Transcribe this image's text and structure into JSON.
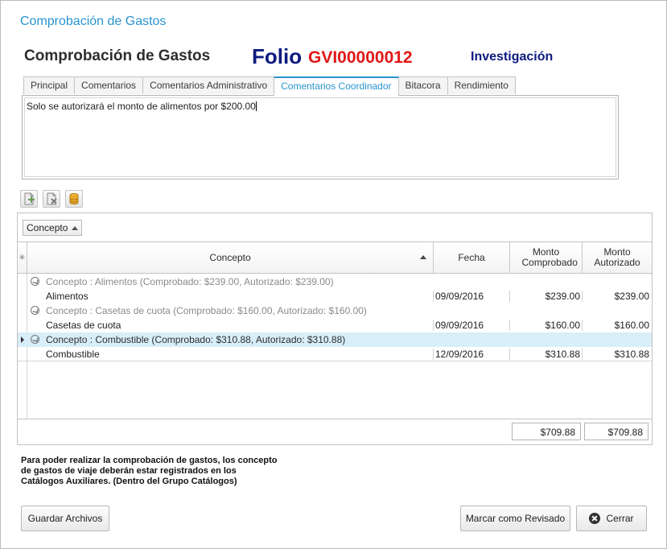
{
  "window": {
    "title": "Comprobación de Gastos"
  },
  "header": {
    "form_title": "Comprobación de Gastos",
    "folio_label": "Folio",
    "folio_number": "GVI00000012",
    "department": "Investigación"
  },
  "tabs": [
    {
      "label": "Principal"
    },
    {
      "label": "Comentarios"
    },
    {
      "label": "Comentarios Administrativo"
    },
    {
      "label": "Comentarios Coordinador",
      "active": true
    },
    {
      "label": "Bitacora"
    },
    {
      "label": "Rendimiento"
    }
  ],
  "comment": {
    "text": "Solo se autorizará el monto de alimentos por $200.00"
  },
  "toolbar": {
    "icons": [
      "add-document-icon",
      "delete-document-icon",
      "database-icon"
    ]
  },
  "grid": {
    "group_by_label": "Concepto",
    "columns": {
      "concepto": "Concepto",
      "fecha": "Fecha",
      "monto_comprobado": "Monto Comprobado",
      "monto_autorizado": "Monto Autorizado"
    },
    "groups": [
      {
        "header": "Concepto : Alimentos (Comprobado: $239.00, Autorizado: $239.00)",
        "row": {
          "concepto": "Alimentos",
          "fecha": "09/09/2016",
          "comprobado": "$239.00",
          "autorizado": "$239.00"
        }
      },
      {
        "header": "Concepto : Casetas de cuota (Comprobado: $160.00, Autorizado: $160.00)",
        "row": {
          "concepto": "Casetas de cuota",
          "fecha": "09/09/2016",
          "comprobado": "$160.00",
          "autorizado": "$160.00"
        }
      },
      {
        "header": "Concepto : Combustible (Comprobado: $310.88, Autorizado: $310.88)",
        "row": {
          "concepto": "Combustible",
          "fecha": "12/09/2016",
          "comprobado": "$310.88",
          "autorizado": "$310.88"
        }
      }
    ],
    "totals": {
      "comprobado": "$709.88",
      "autorizado": "$709.88"
    }
  },
  "note": {
    "lines": [
      "Para poder realizar la comprobación de gastos, los concepto",
      "de gastos de viaje deberán estar registrados en los",
      "Catálogos Auxiliares. (Dentro del Grupo Catálogos)"
    ]
  },
  "buttons": {
    "save_files": "Guardar Archivos",
    "mark_reviewed": "Marcar como Revisado",
    "close": "Cerrar"
  },
  "colors": {
    "accent": "#2a93cf",
    "folio_blue": "#0d1a80",
    "folio_red": "#e01818",
    "selected_row": "#d8eef9"
  }
}
